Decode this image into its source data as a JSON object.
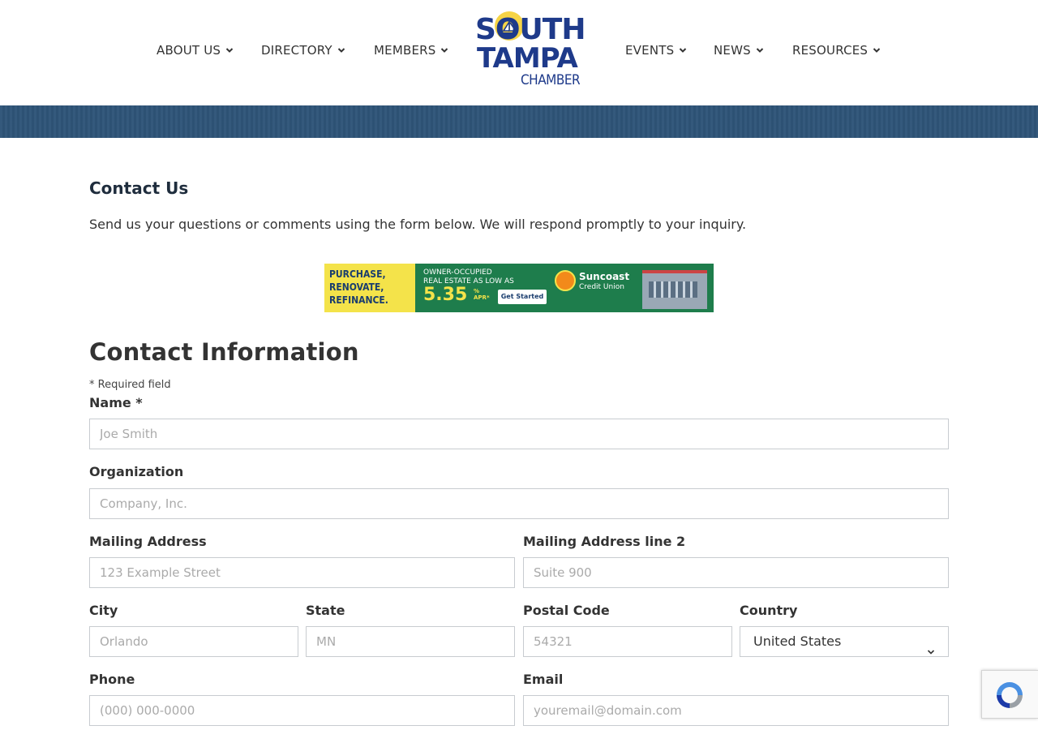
{
  "nav": {
    "left": [
      {
        "label": "ABOUT US"
      },
      {
        "label": "DIRECTORY"
      },
      {
        "label": "MEMBERS"
      }
    ],
    "right": [
      {
        "label": "EVENTS"
      },
      {
        "label": "NEWS"
      },
      {
        "label": "RESOURCES"
      }
    ]
  },
  "logo": {
    "line1": "SOUTH",
    "line2": "TAMPA",
    "line3": "CHAMBER"
  },
  "page": {
    "title": "Contact Us",
    "intro": "Send us your questions or comments using the form below. We will respond promptly to your inquiry."
  },
  "banner": {
    "headline1": "PURCHASE,",
    "headline2": "RENOVATE,",
    "headline3": "REFINANCE.",
    "sub1": "OWNER-OCCUPIED",
    "sub2": "REAL ESTATE AS LOW AS",
    "rate": "5.35",
    "rate_suffix": "% APR*",
    "button": "Get Started",
    "brand1": "Suncoast",
    "brand2": "Credit Union"
  },
  "form": {
    "section_title": "Contact Information",
    "required_note": "* Required field",
    "name": {
      "label": "Name *",
      "placeholder": "Joe Smith"
    },
    "organization": {
      "label": "Organization",
      "placeholder": "Company, Inc."
    },
    "mailing_address": {
      "label": "Mailing Address",
      "placeholder": "123 Example Street"
    },
    "mailing_address_2": {
      "label": "Mailing Address line 2",
      "placeholder": "Suite 900"
    },
    "city": {
      "label": "City",
      "placeholder": "Orlando"
    },
    "state": {
      "label": "State",
      "placeholder": "MN"
    },
    "postal_code": {
      "label": "Postal Code",
      "placeholder": "54321"
    },
    "country": {
      "label": "Country",
      "value": "United States"
    },
    "phone": {
      "label": "Phone",
      "placeholder": "(000) 000-0000"
    },
    "email": {
      "label": "Email",
      "placeholder": "youremail@domain.com"
    }
  },
  "colors": {
    "brand_navy": "#1e3a8a",
    "hero_band": "#2e5478",
    "logo_sun": "#f5d23c"
  }
}
